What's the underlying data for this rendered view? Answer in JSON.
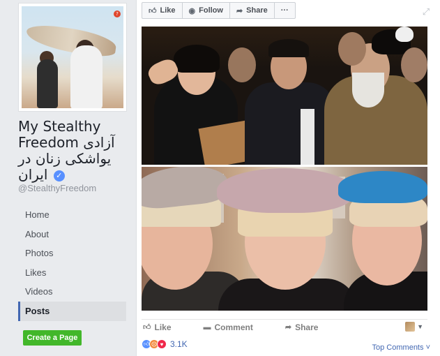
{
  "page": {
    "name": "My Stealthy Freedom آزادی یواشکی زنان در ایران",
    "handle": "@StealthyFreedom",
    "verified_icon": "verified-check-icon",
    "profile_logo_text": "آزادی یواشکی زنان در ایران"
  },
  "nav": {
    "items": [
      {
        "label": "Home"
      },
      {
        "label": "About"
      },
      {
        "label": "Photos"
      },
      {
        "label": "Likes"
      },
      {
        "label": "Videos"
      },
      {
        "label": "Posts",
        "active": true
      }
    ],
    "create_page": "Create a Page"
  },
  "top_actions": {
    "like": "Like",
    "follow": "Follow",
    "share": "Share",
    "more": "···"
  },
  "post_actions": {
    "like": "Like",
    "comment": "Comment",
    "share": "Share"
  },
  "reactions": {
    "count": "3.1K",
    "types": [
      "like",
      "angry",
      "love"
    ]
  },
  "comments": {
    "sort_label": "Top Comments"
  },
  "colors": {
    "brand_blue": "#4267b2",
    "create_green": "#42b72a",
    "background": "#e9ebee"
  }
}
